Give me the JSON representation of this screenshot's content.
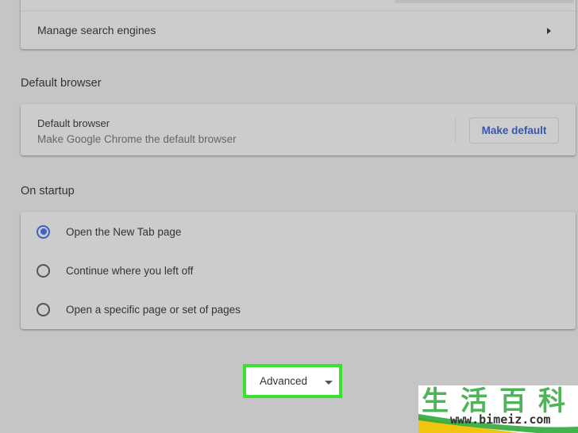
{
  "search_engine": {
    "manage_label": "Manage search engines"
  },
  "default_browser": {
    "section_title": "Default browser",
    "row_title": "Default browser",
    "row_subtitle": "Make Google Chrome the default browser",
    "button_label": "Make default"
  },
  "startup": {
    "section_title": "On startup",
    "options": [
      {
        "label": "Open the New Tab page",
        "selected": true
      },
      {
        "label": "Continue where you left off",
        "selected": false
      },
      {
        "label": "Open a specific page or set of pages",
        "selected": false
      }
    ]
  },
  "advanced": {
    "label": "Advanced",
    "highlight_color": "#35e42b"
  },
  "watermark": {
    "chars": "生活百科",
    "url": "www.bimeiz.com"
  },
  "colors": {
    "accent": "#3c63c6",
    "button_text": "#3a56a8",
    "page_bg": "#c5c5c5"
  }
}
